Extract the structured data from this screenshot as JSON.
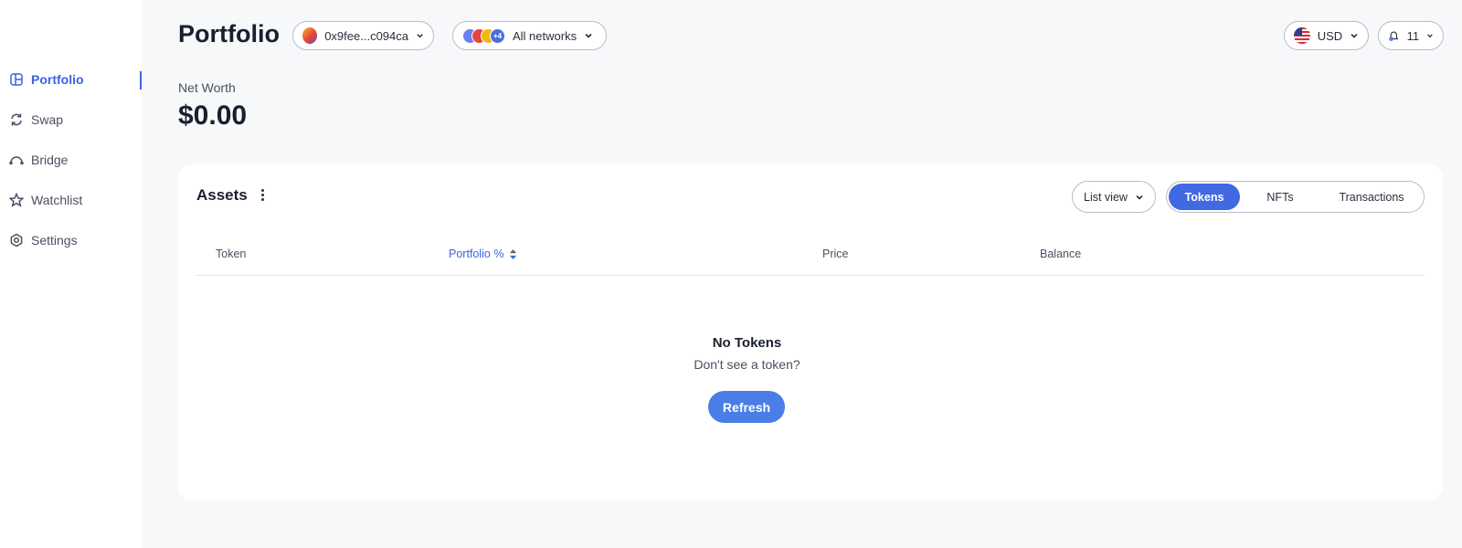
{
  "sidebar": {
    "items": [
      {
        "label": "Portfolio",
        "icon": "portfolio-icon",
        "active": true
      },
      {
        "label": "Swap",
        "icon": "swap-icon"
      },
      {
        "label": "Bridge",
        "icon": "bridge-icon"
      },
      {
        "label": "Watchlist",
        "icon": "star-icon"
      },
      {
        "label": "Settings",
        "icon": "settings-icon"
      }
    ]
  },
  "header": {
    "title": "Portfolio",
    "account": "0x9fee...c094ca",
    "networks_label": "All networks",
    "networks_more": "+4",
    "currency": "USD",
    "notifications_count": "11"
  },
  "net_worth": {
    "label": "Net Worth",
    "value": "$0.00"
  },
  "assets": {
    "title": "Assets",
    "view_mode": "List view",
    "tabs": [
      "Tokens",
      "NFTs",
      "Transactions"
    ],
    "active_tab": "Tokens",
    "columns": [
      "Token",
      "Portfolio %",
      "Price",
      "Balance"
    ],
    "sorted_column": "Portfolio %",
    "empty_title": "No Tokens",
    "empty_subtitle": "Don't see a token?",
    "refresh_label": "Refresh"
  },
  "colors": {
    "accent": "#3b63e0",
    "tab_active": "#4169e1",
    "refresh": "#4a7de8",
    "background": "#f7f8fa"
  }
}
